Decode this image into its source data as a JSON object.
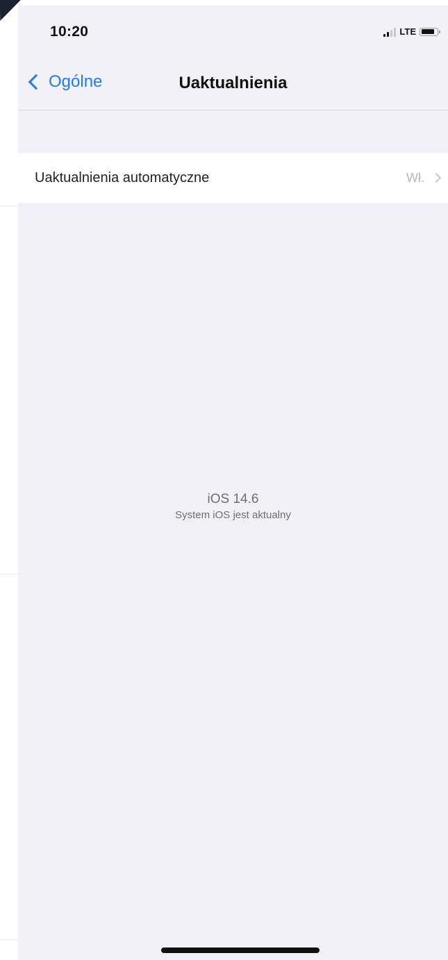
{
  "status_bar": {
    "time": "10:20",
    "network": "LTE",
    "signal_bars_filled": 2,
    "signal_bars_total": 4,
    "icons": [
      "signal-icon",
      "battery-icon"
    ]
  },
  "nav": {
    "back_label": "Ogólne",
    "title": "Uaktualnienia",
    "back_icon": "chevron-left-icon"
  },
  "settings": {
    "auto_updates_label": "Uaktualnienia automatyczne",
    "auto_updates_value": "Wł.",
    "chevron_icon": "chevron-right-icon"
  },
  "update_info": {
    "version": "iOS 14.6",
    "status": "System iOS jest aktualny"
  },
  "colors": {
    "accent": "#1f7cf0",
    "background": "#f1f1f7",
    "secondary_text": "#6d6d72"
  }
}
